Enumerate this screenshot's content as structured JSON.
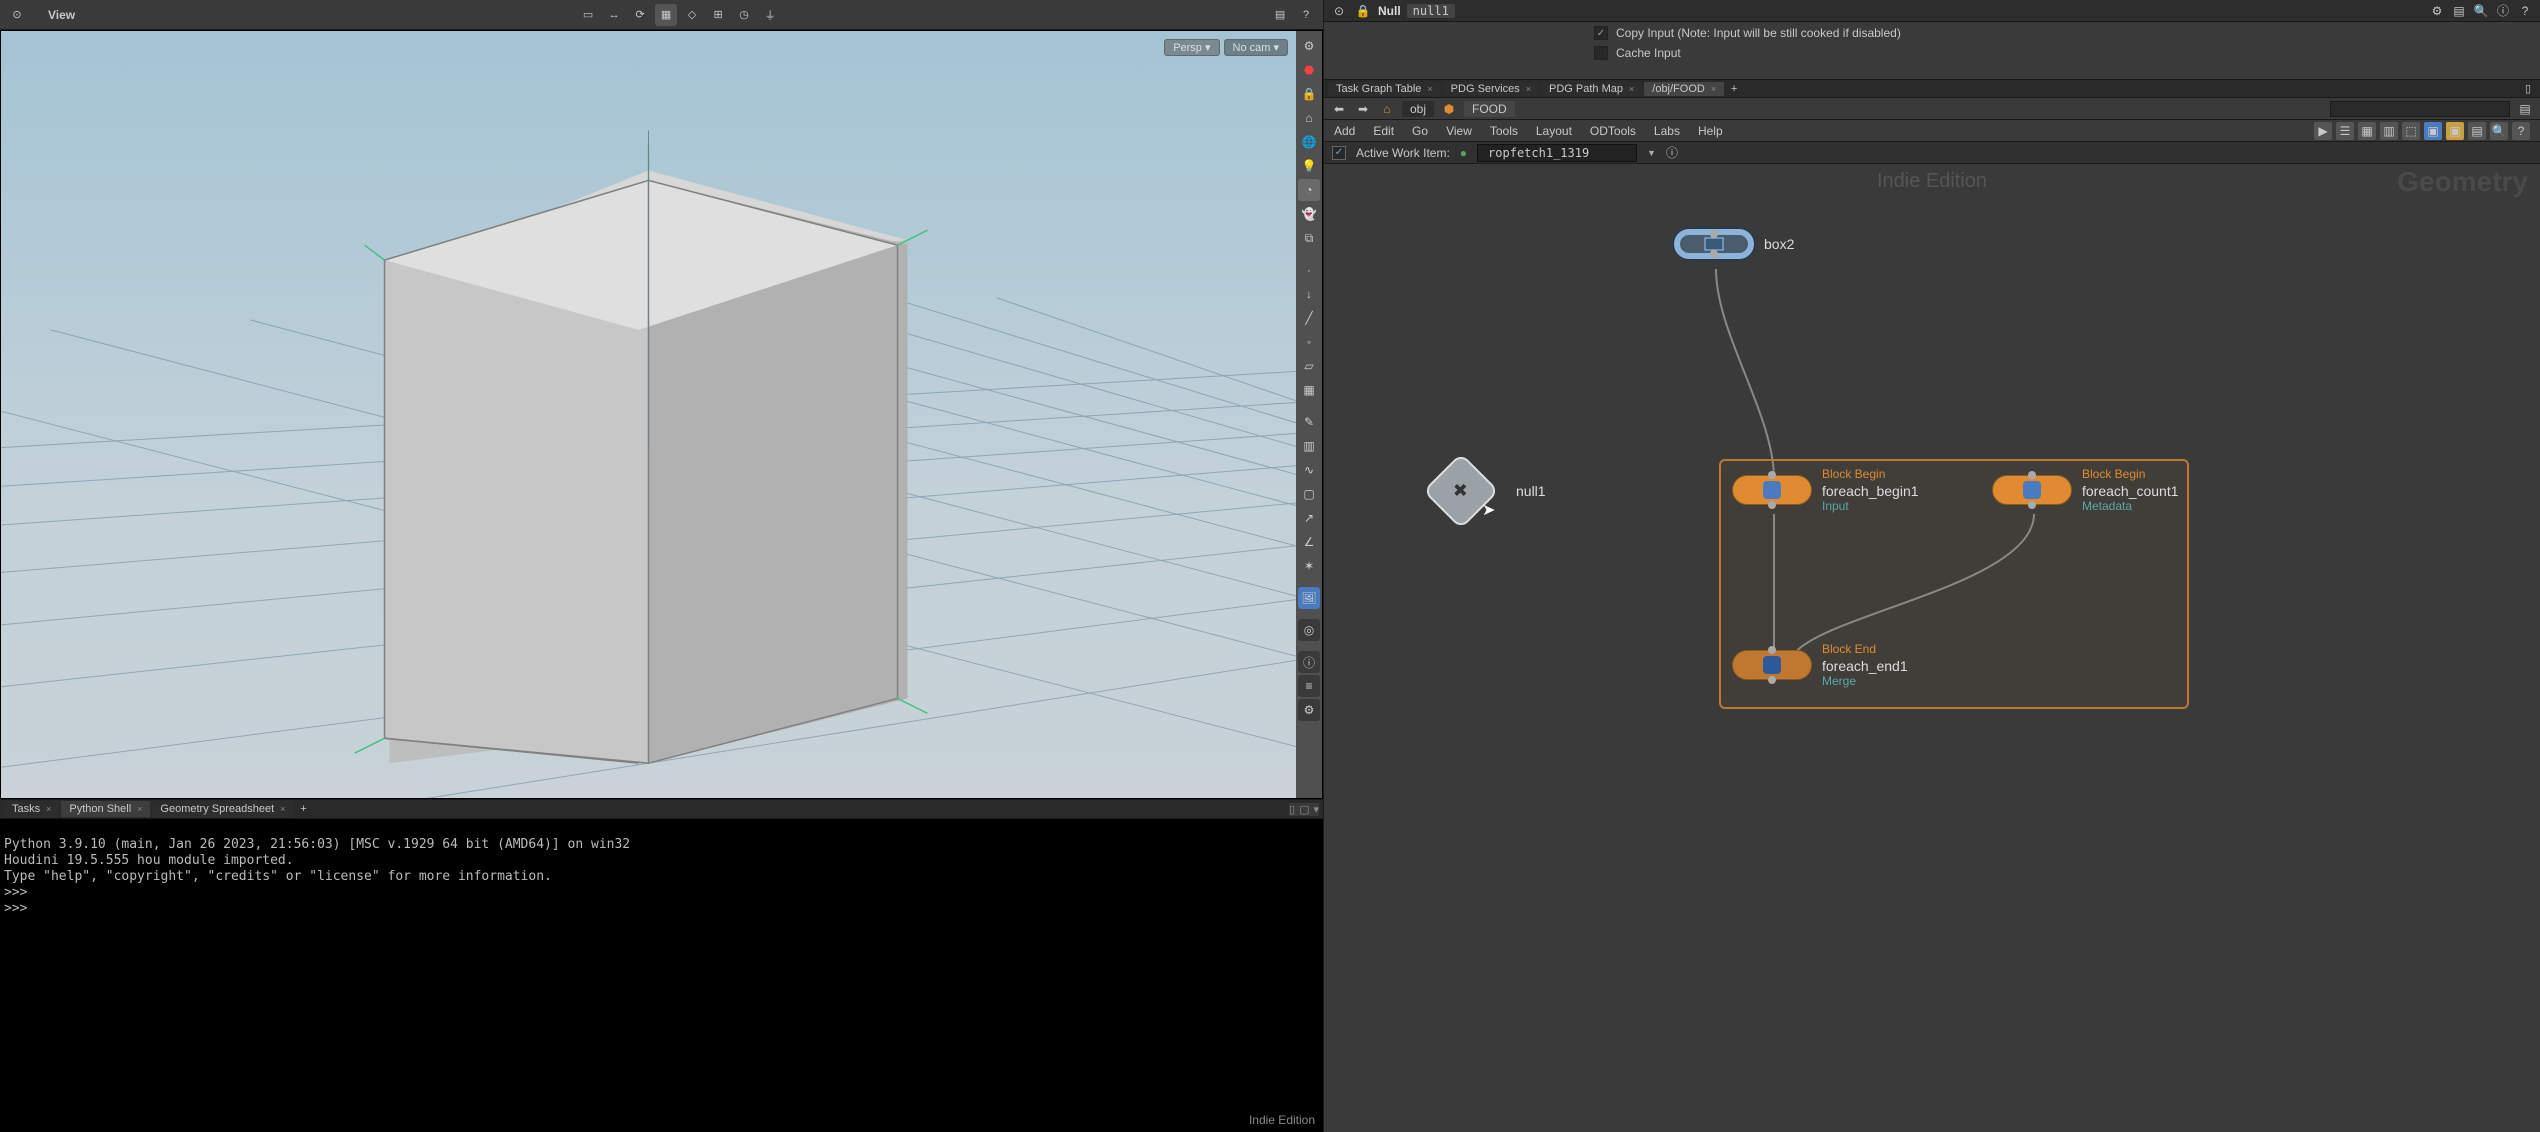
{
  "viewport": {
    "title": "View",
    "pill_persp": "Persp ▾",
    "pill_cam": "No cam ▾",
    "corner_label": ""
  },
  "bottom_tabs": {
    "items": [
      "Tasks",
      "Python Shell",
      "Geometry Spreadsheet"
    ]
  },
  "console": {
    "line1": "Python 3.9.10 (main, Jan 26 2023, 21:56:03) [MSC v.1929 64 bit (AMD64)] on win32",
    "line2": "Houdini 19.5.555 hou module imported.",
    "line3": "Type \"help\", \"copyright\", \"credits\" or \"license\" for more information.",
    "prompt": ">>> ",
    "prompt2": ">>> ",
    "indie_label": "Indie Edition"
  },
  "parm": {
    "type": "Null",
    "name": "null1",
    "copy_input": "Copy Input (Note: Input will be still cooked if disabled)",
    "cache_input": "Cache Input"
  },
  "net_tabs": {
    "items": [
      "Task Graph Table",
      "PDG Services",
      "PDG Path Map",
      "/obj/FOOD"
    ]
  },
  "net_path": {
    "segments": [
      "obj",
      "FOOD"
    ]
  },
  "net_menu": {
    "items": [
      "Add",
      "Edit",
      "Go",
      "View",
      "Tools",
      "Layout",
      "ODTools",
      "Labs",
      "Help"
    ]
  },
  "work_item": {
    "label": "Active Work Item:",
    "value": "ropfetch1_1319"
  },
  "watermarks": {
    "indie": "Indie Edition",
    "geo": "Geometry"
  },
  "nodes": {
    "box": {
      "label": "box2"
    },
    "null": {
      "label": "null1"
    },
    "foreach_begin": {
      "title": "Block Begin",
      "label": "foreach_begin1",
      "sub": "Input"
    },
    "foreach_count": {
      "title": "Block Begin",
      "label": "foreach_count1",
      "sub": "Metadata"
    },
    "foreach_end": {
      "title": "Block End",
      "label": "foreach_end1",
      "sub": "Merge"
    }
  }
}
